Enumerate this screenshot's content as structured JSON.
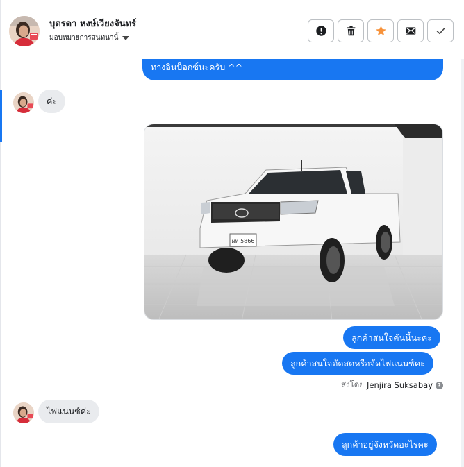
{
  "header": {
    "contact_name": "บุตรดา หงษ์เวียงจันทร์",
    "assign_label": "มอบหมายการสนทนานี้"
  },
  "actions": [
    {
      "name": "mark-spam-button",
      "icon": "exclamation-circle-icon"
    },
    {
      "name": "delete-button",
      "icon": "trash-icon"
    },
    {
      "name": "star-button",
      "icon": "star-icon",
      "color": "#f7923a"
    },
    {
      "name": "mark-unread-button",
      "icon": "envelope-icon"
    },
    {
      "name": "mark-done-button",
      "icon": "check-icon"
    }
  ],
  "messages": [
    {
      "id": "m1",
      "direction": "outgoing",
      "text": "ทางอินบ็อกซ์นะครับ ^^"
    },
    {
      "id": "m2",
      "direction": "incoming",
      "text": "ค่ะ"
    },
    {
      "id": "m3",
      "direction": "outgoing",
      "type": "image",
      "content": "white pickup truck photo",
      "plate_text": "ผห 5866"
    },
    {
      "id": "m4",
      "direction": "outgoing",
      "text": "ลูกค้าสนใจคันนี้นะคะ"
    },
    {
      "id": "m5",
      "direction": "outgoing",
      "text": "ลูกค้าสนใจตัดสดหรือจัดไฟแนนซ์คะ"
    },
    {
      "id": "m6",
      "direction": "incoming",
      "text": "ไฟแนนซ์ค่ะ"
    },
    {
      "id": "m7",
      "direction": "outgoing",
      "text": "ลูกค้าอยู่จังหวัดอะไรคะ"
    }
  ],
  "sent_by": {
    "prefix": "ส่งโดย",
    "agent": "Jenjira Suksabay"
  },
  "colors": {
    "accent": "#1877f2",
    "incoming_bubble": "#e9ebee",
    "star": "#f7923a"
  }
}
